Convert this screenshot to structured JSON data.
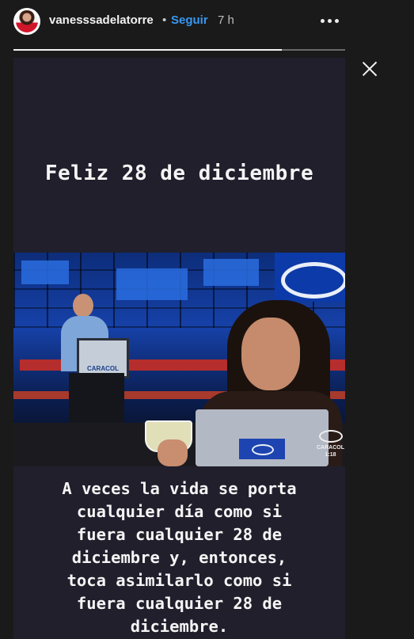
{
  "header": {
    "username": "vanesssadelatorre",
    "separator": "•",
    "follow_label": "Seguir",
    "time_ago": "7 h",
    "more_icon": "more-horizontal-icon",
    "close_icon": "close-icon"
  },
  "progress": {
    "fraction": 0.81
  },
  "story": {
    "background": "#211f2c",
    "headline": "Feliz 28 de diciembre",
    "video_overlay": {
      "monitor_label": "CARACOL",
      "bug_label": "CARACOL",
      "bug_time": "1:18"
    },
    "caption_lines": [
      "A veces la vida se porta",
      "cualquier día como si",
      "fuera cualquier 28 de",
      "diciembre y, entonces,",
      "toca asimilarlo como si",
      "fuera cualquier 28 de",
      "diciembre."
    ]
  },
  "colors": {
    "accent": "#3897f0",
    "text": "#f5f5f5"
  }
}
